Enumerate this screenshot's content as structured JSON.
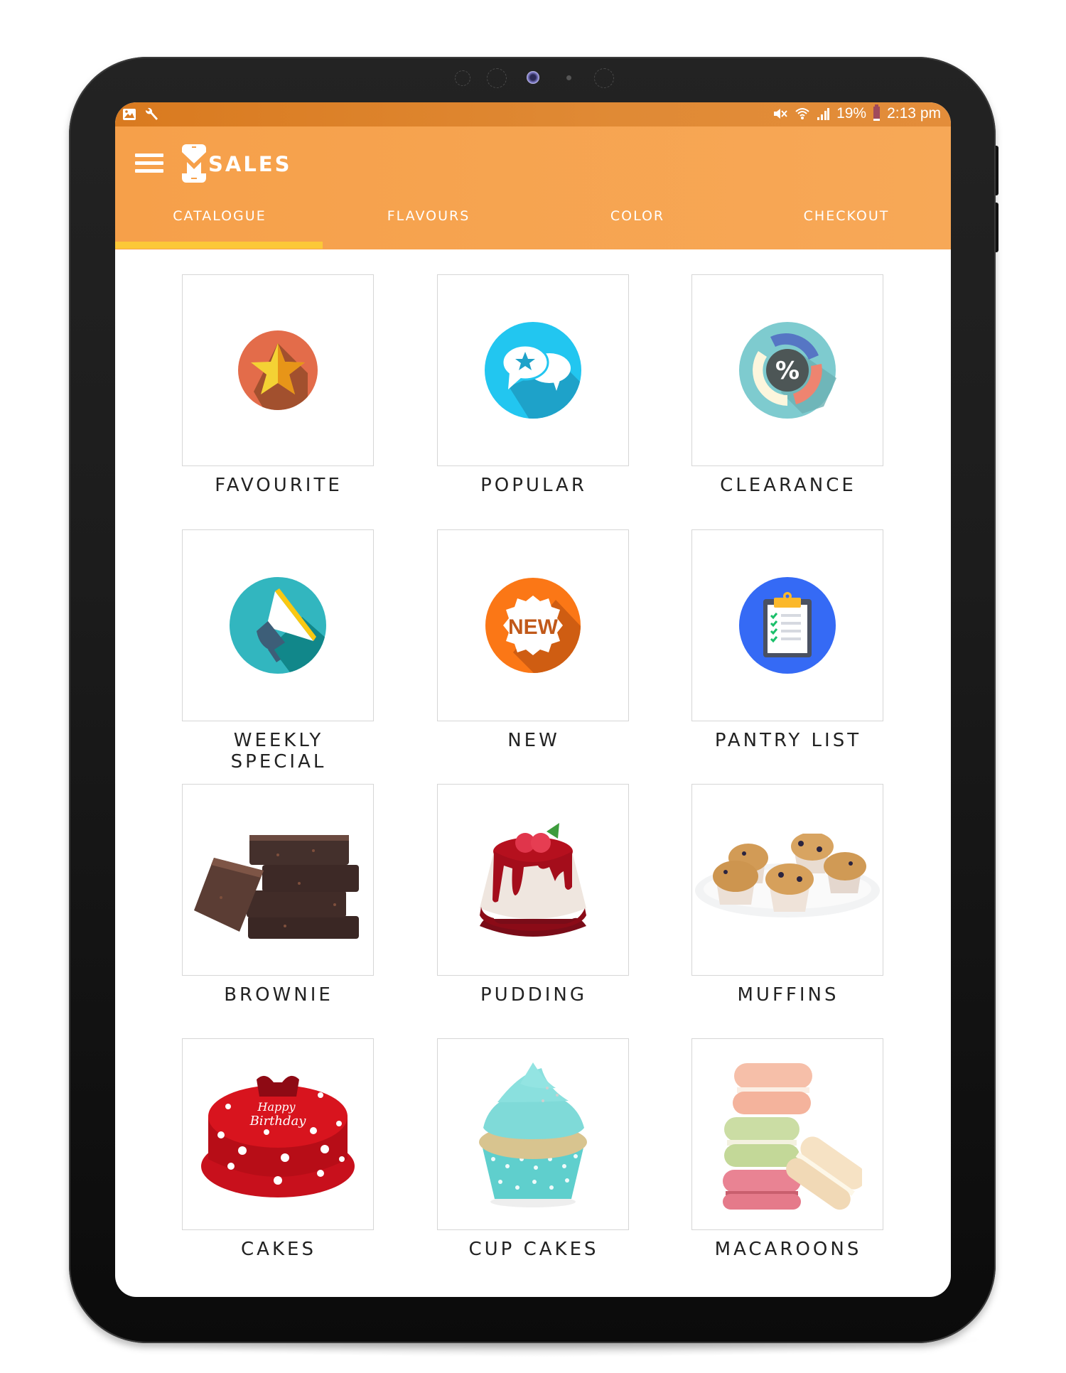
{
  "status_bar": {
    "left_icons": [
      "image-notification-icon",
      "wrench-icon"
    ],
    "right_icons": [
      "mute-icon",
      "wifi-icon",
      "signal-icon"
    ],
    "battery_percent": "19%",
    "time": "2:13 pm"
  },
  "app_bar": {
    "menu_icon": "hamburger-icon",
    "logo_text": "SALES",
    "logo_letter": "M",
    "brand_color": "#f6a04a",
    "indicator_color": "#fcc838"
  },
  "tabs": [
    {
      "label": "CATALOGUE",
      "active": true
    },
    {
      "label": "FLAVOURS",
      "active": false
    },
    {
      "label": "COLOR",
      "active": false
    },
    {
      "label": "CHECKOUT",
      "active": false
    }
  ],
  "catalogue": [
    {
      "label": "FAVOURITE",
      "icon": "star-badge-icon"
    },
    {
      "label": "POPULAR",
      "icon": "chat-bubbles-star-icon"
    },
    {
      "label": "CLEARANCE",
      "icon": "percent-chart-icon"
    },
    {
      "label": "WEEKLY SPECIAL",
      "icon": "megaphone-icon"
    },
    {
      "label": "NEW",
      "icon": "new-badge-icon",
      "badge_text": "NEW"
    },
    {
      "label": "PANTRY LIST",
      "icon": "clipboard-checklist-icon"
    },
    {
      "label": "BROWNIE",
      "icon": "brownie-image"
    },
    {
      "label": "PUDDING",
      "icon": "pudding-image"
    },
    {
      "label": "MUFFINS",
      "icon": "muffins-image"
    },
    {
      "label": "CAKES",
      "icon": "birthday-cake-image",
      "cake_text_1": "Happy",
      "cake_text_2": "Birthday"
    },
    {
      "label": "CUP CAKES",
      "icon": "cupcake-image"
    },
    {
      "label": "MACAROONS",
      "icon": "macaroons-image"
    }
  ]
}
